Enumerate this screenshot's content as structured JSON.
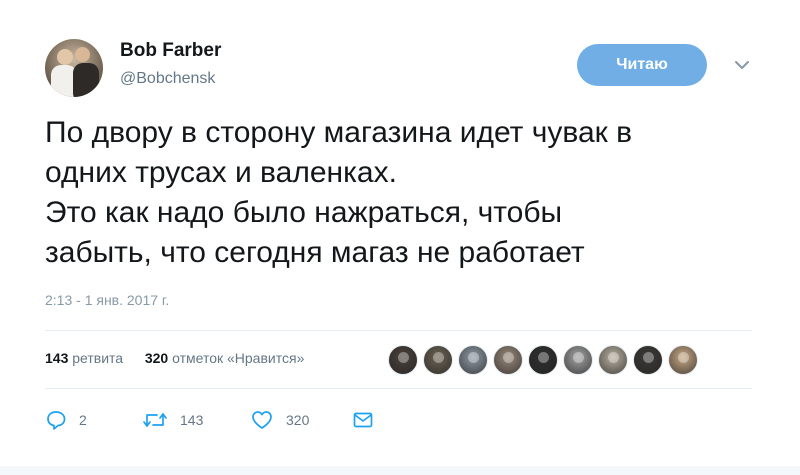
{
  "author": {
    "name": "Bob Farber",
    "handle": "@Bobchensk"
  },
  "follow_button": {
    "label": "Читаю"
  },
  "tweet": {
    "text": "По двору в сторону магазина идет чувак в\nодних трусах и валенках.\nЭто как надо было нажраться, чтобы\nзабыть, что сегодня магаз не работает",
    "timestamp": "2:13 - 1 янв. 2017 г."
  },
  "stats": {
    "retweets_count": "143",
    "retweets_label": "ретвита",
    "likes_count": "320",
    "likes_label": "отметок «Нравится»"
  },
  "likers": [
    {
      "color": "#4a403a"
    },
    {
      "color": "#6b6252"
    },
    {
      "color": "#8e9aa6"
    },
    {
      "color": "#9a8a7c"
    },
    {
      "color": "#2f2f2f"
    },
    {
      "color": "#a3a3a3"
    },
    {
      "color": "#b9b0a0"
    },
    {
      "color": "#3d3a36"
    },
    {
      "color": "#c8a884"
    }
  ],
  "actions": {
    "reply_count": "2",
    "retweet_count": "143",
    "like_count": "320"
  },
  "colors": {
    "accent": "#72aee6",
    "text": "#14171a",
    "muted": "#657786",
    "icon": "#1da1f2"
  },
  "icons": {
    "reply": "reply-icon",
    "retweet": "retweet-icon",
    "like": "heart-icon",
    "dm": "envelope-icon",
    "menu": "chevron-down-icon"
  }
}
